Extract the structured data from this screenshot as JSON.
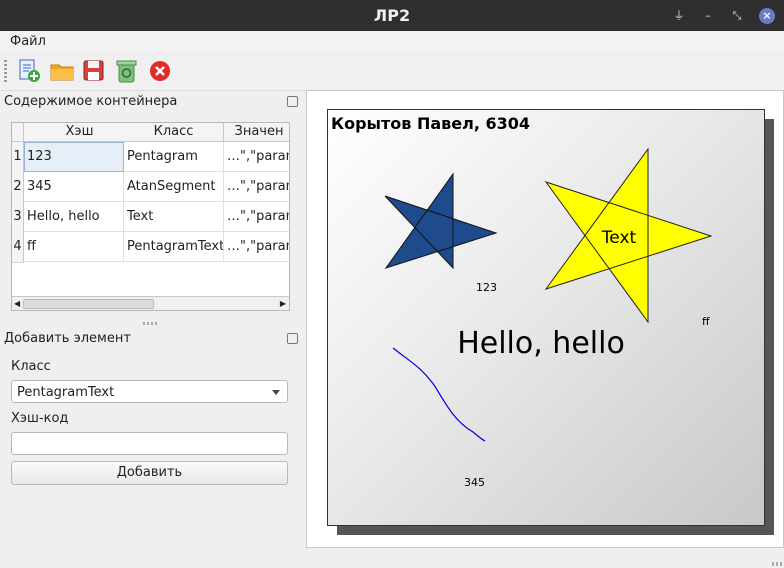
{
  "window": {
    "title": "ЛР2"
  },
  "menu": {
    "file": "Файл"
  },
  "toolbar": {
    "icons": [
      "new-file-icon",
      "open-folder-icon",
      "save-icon",
      "recycle-bin-icon",
      "close-icon"
    ]
  },
  "container_panel": {
    "title": "Содержимое контейнера",
    "columns": [
      "Хэш",
      "Класс",
      "Значен"
    ],
    "rows": [
      {
        "n": "1",
        "hash": "123",
        "cls": "Pentagram",
        "val": "…\",\"param"
      },
      {
        "n": "2",
        "hash": "345",
        "cls": "AtanSegment",
        "val": "…\",\"param"
      },
      {
        "n": "3",
        "hash": "Hello, hello",
        "cls": "Text",
        "val": "…\",\"param"
      },
      {
        "n": "4",
        "hash": "ff",
        "cls": "PentagramText",
        "val": "…\",\"param"
      }
    ]
  },
  "add_panel": {
    "title": "Добавить элемент",
    "class_label": "Класс",
    "class_value": "PentagramText",
    "hash_label": "Хэш-код",
    "hash_value": "",
    "add_button": "Добавить"
  },
  "canvas": {
    "title": "Корытов Павел, 6304",
    "star1_label": "123",
    "star2_text": "Text",
    "star2_label": "ff",
    "big_text": "Hello, hello",
    "segment_label": "345",
    "colors": {
      "star1": "#1f4a8c",
      "star2": "#ffff00",
      "segment": "#0000dd"
    }
  }
}
